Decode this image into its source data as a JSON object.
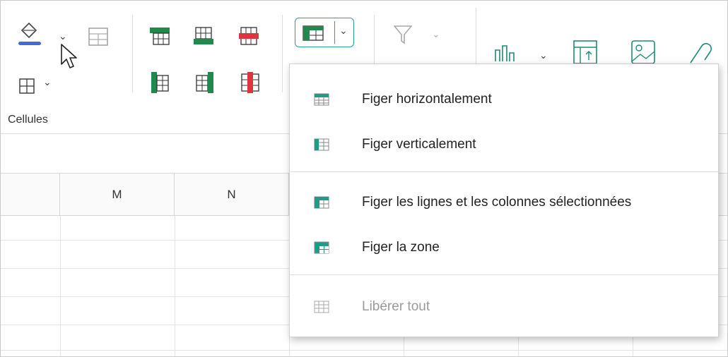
{
  "ribbon": {
    "cells_group_label": "Cellules",
    "icons": {
      "fill_color": "fill-color-icon",
      "borders": "borders-icon",
      "cell_format": "cell-format-icon",
      "insert_rows_above": "insert-row-above-icon",
      "insert_rows_below": "insert-row-below-icon",
      "delete_rows": "delete-row-icon",
      "insert_col_left": "insert-column-left-icon",
      "insert_col_right": "insert-column-right-icon",
      "delete_col": "delete-column-icon",
      "freeze": "freeze-panes-icon",
      "filter": "filter-icon",
      "chart": "bar-chart-icon",
      "pivot": "pivot-table-icon",
      "image": "image-icon",
      "link": "link-icon"
    }
  },
  "grid": {
    "columns": [
      "M",
      "N"
    ]
  },
  "freeze_menu": {
    "items": [
      {
        "label": "Figer horizontalement",
        "icon": "freeze-rows-icon",
        "enabled": true
      },
      {
        "label": "Figer verticalement",
        "icon": "freeze-columns-icon",
        "enabled": true
      },
      {
        "label": "Figer les lignes et les colonnes sélectionnées",
        "icon": "freeze-rows-columns-icon",
        "enabled": true
      },
      {
        "label": "Figer la zone",
        "icon": "freeze-area-icon",
        "enabled": true
      },
      {
        "label": "Libérer tout",
        "icon": "unfreeze-all-icon",
        "enabled": false
      }
    ]
  },
  "colors": {
    "accent": "#28a199",
    "green": "#1e8a4c",
    "red": "#d9363e",
    "blue_line": "#3b6fd6",
    "disabled_text": "#9a9a9a"
  }
}
